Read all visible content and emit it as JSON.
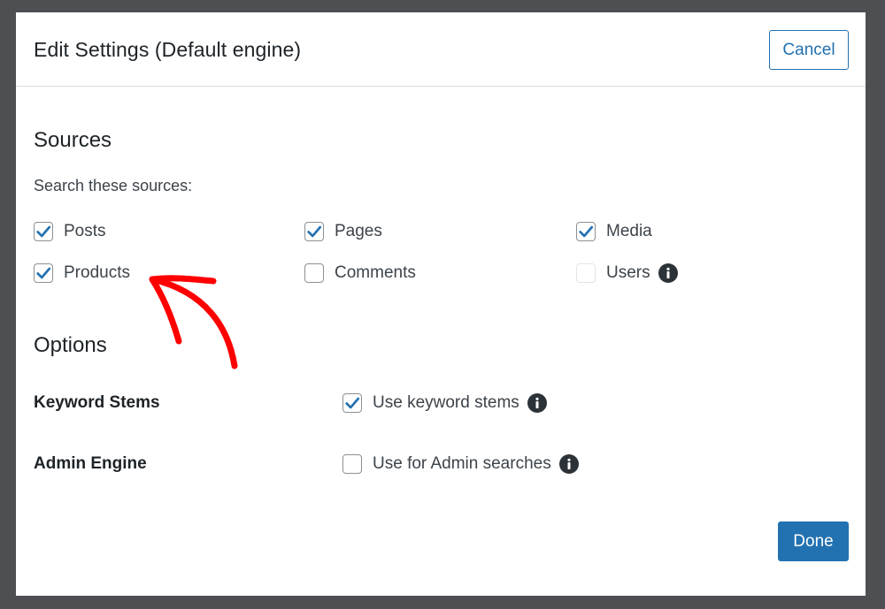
{
  "modal": {
    "title": "Edit Settings (Default engine)",
    "cancel_label": "Cancel",
    "done_label": "Done"
  },
  "sources": {
    "heading": "Sources",
    "hint": "Search these sources:",
    "items": [
      {
        "label": "Posts",
        "checked": true
      },
      {
        "label": "Pages",
        "checked": true
      },
      {
        "label": "Media",
        "checked": true
      },
      {
        "label": "Products",
        "checked": true
      },
      {
        "label": "Comments",
        "checked": false
      },
      {
        "label": "Users",
        "checked": false,
        "disabled": true,
        "has_info": true
      }
    ]
  },
  "options": {
    "heading": "Options",
    "keyword_stems": {
      "label": "Keyword Stems",
      "checkbox_label": "Use keyword stems",
      "checked": true
    },
    "admin_engine": {
      "label": "Admin Engine",
      "checkbox_label": "Use for Admin searches",
      "checked": false
    }
  },
  "colors": {
    "accent": "#2271b1",
    "annotation": "#ff0000",
    "backdrop": "#4d4f52"
  },
  "icons": {
    "checkmark": "checkmark-icon",
    "info": "info-icon",
    "annotation": "red-arrow-annotation"
  }
}
